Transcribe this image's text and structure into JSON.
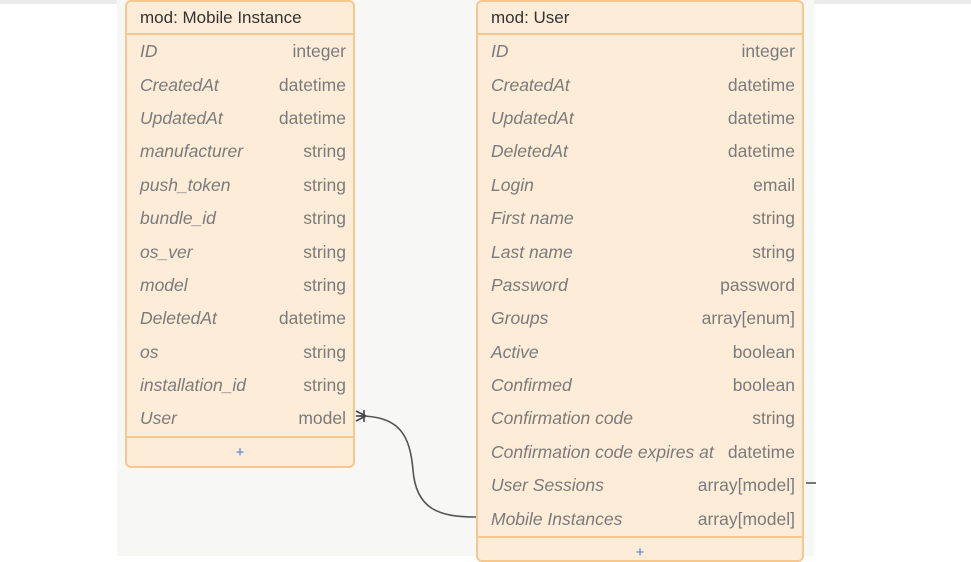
{
  "entities": [
    {
      "id": "mobile",
      "title": "mod: Mobile Instance",
      "fields": [
        {
          "name": "ID",
          "type": "integer"
        },
        {
          "name": "CreatedAt",
          "type": "datetime"
        },
        {
          "name": "UpdatedAt",
          "type": "datetime"
        },
        {
          "name": "manufacturer",
          "type": "string"
        },
        {
          "name": "push_token",
          "type": "string"
        },
        {
          "name": "bundle_id",
          "type": "string"
        },
        {
          "name": "os_ver",
          "type": "string"
        },
        {
          "name": "model",
          "type": "string"
        },
        {
          "name": "DeletedAt",
          "type": "datetime"
        },
        {
          "name": "os",
          "type": "string"
        },
        {
          "name": "installation_id",
          "type": "string"
        },
        {
          "name": "User",
          "type": "model"
        }
      ],
      "add_label": "+"
    },
    {
      "id": "user",
      "title": "mod: User",
      "fields": [
        {
          "name": "ID",
          "type": "integer"
        },
        {
          "name": "CreatedAt",
          "type": "datetime"
        },
        {
          "name": "UpdatedAt",
          "type": "datetime"
        },
        {
          "name": "DeletedAt",
          "type": "datetime"
        },
        {
          "name": "Login",
          "type": "email"
        },
        {
          "name": "First name",
          "type": "string"
        },
        {
          "name": "Last name",
          "type": "string"
        },
        {
          "name": "Password",
          "type": "password"
        },
        {
          "name": "Groups",
          "type": "array[enum]"
        },
        {
          "name": "Active",
          "type": "boolean"
        },
        {
          "name": "Confirmed",
          "type": "boolean"
        },
        {
          "name": "Confirmation code",
          "type": "string"
        },
        {
          "name": "Confirmation code expires at",
          "type": "datetime"
        },
        {
          "name": "User Sessions",
          "type": "array[model]"
        },
        {
          "name": "Mobile Instances",
          "type": "array[model]"
        }
      ],
      "add_label": "+"
    }
  ],
  "colors": {
    "entity_bg": "#fdecd8",
    "entity_border": "#f6c88e",
    "link": "#555555",
    "add_button": "#3f7fe0"
  }
}
